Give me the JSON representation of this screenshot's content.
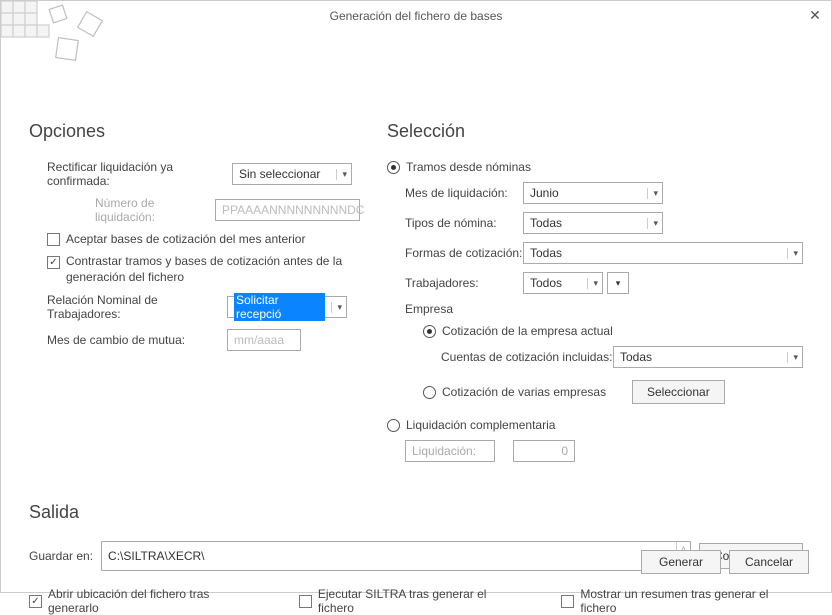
{
  "window": {
    "title": "Generación del fichero de bases"
  },
  "opciones": {
    "heading": "Opciones",
    "rectificar_label": "Rectificar liquidación ya confirmada:",
    "rectificar_value": "Sin seleccionar",
    "num_liquidacion_label": "Número de liquidación:",
    "num_liquidacion_placeholder": "PPAAAANNNNNNNNNDC",
    "aceptar_bases_label": "Aceptar bases de cotización del mes anterior",
    "contrastar_label": "Contrastar tramos y bases de cotización antes de la generación del fichero",
    "relacion_label": "Relación Nominal de Trabajadores:",
    "relacion_value": "Solicitar recepció",
    "mes_mutua_label": "Mes de cambio de mutua:",
    "mes_mutua_placeholder": "mm/aaaa"
  },
  "seleccion": {
    "heading": "Selección",
    "tramos_radio_label": "Tramos desde nóminas",
    "mes_liq_label": "Mes de liquidación:",
    "mes_liq_value": "Junio",
    "tipos_nomina_label": "Tipos de nómina:",
    "tipos_nomina_value": "Todas",
    "formas_cot_label": "Formas de cotización:",
    "formas_cot_value": "Todas",
    "trabajadores_label": "Trabajadores:",
    "trabajadores_value": "Todos",
    "empresa_label": "Empresa",
    "empresa_actual_label": "Cotización de la empresa actual",
    "cuentas_incluidas_label": "Cuentas de cotización incluidas:",
    "cuentas_incluidas_value": "Todas",
    "varias_empresas_label": "Cotización de varias empresas",
    "seleccionar_btn": "Seleccionar",
    "liq_compl_label": "Liquidación complementaria",
    "liquidacion_sub_label": "Liquidación:",
    "liquidacion_sub_value": "0"
  },
  "salida": {
    "heading": "Salida",
    "guardar_label": "Guardar en:",
    "guardar_path": "C:\\SILTRA\\XECR\\",
    "config_btn": "Configuración",
    "abrir_chk_label": "Abrir ubicación del fichero tras generarlo",
    "ejecutar_chk_label": "Ejecutar SILTRA tras generar el fichero",
    "resumen_chk_label": "Mostrar un resumen tras generar el fichero"
  },
  "footer": {
    "generar": "Generar",
    "cancelar": "Cancelar"
  }
}
